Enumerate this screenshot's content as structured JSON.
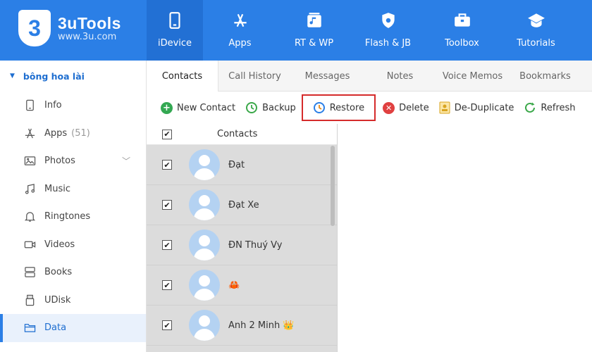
{
  "app": {
    "name": "3uTools",
    "url": "www.3u.com"
  },
  "nav": [
    {
      "label": "iDevice",
      "icon": "phone-icon"
    },
    {
      "label": "Apps",
      "icon": "app-store-icon"
    },
    {
      "label": "RT & WP",
      "icon": "music-note-icon"
    },
    {
      "label": "Flash & JB",
      "icon": "shield-icon"
    },
    {
      "label": "Toolbox",
      "icon": "toolbox-icon"
    },
    {
      "label": "Tutorials",
      "icon": "graduation-cap-icon"
    }
  ],
  "sidebar": {
    "device": "bông hoa lài",
    "items": [
      {
        "label": "Info",
        "icon": "info-icon"
      },
      {
        "label": "Apps",
        "count": "(51)",
        "icon": "apps-icon"
      },
      {
        "label": "Photos",
        "icon": "photo-icon"
      },
      {
        "label": "Music",
        "icon": "music-icon"
      },
      {
        "label": "Ringtones",
        "icon": "bell-icon"
      },
      {
        "label": "Videos",
        "icon": "video-icon"
      },
      {
        "label": "Books",
        "icon": "book-icon"
      },
      {
        "label": "UDisk",
        "icon": "usb-icon"
      },
      {
        "label": "Data",
        "icon": "folder-icon"
      }
    ]
  },
  "tabs": [
    "Contacts",
    "Call History",
    "Messages",
    "Notes",
    "Voice Memos",
    "Bookmarks"
  ],
  "toolbar": {
    "new_contact": "New Contact",
    "backup": "Backup",
    "restore": "Restore",
    "delete": "Delete",
    "dedupe": "De-Duplicate",
    "refresh": "Refresh"
  },
  "contacts": {
    "header": "Contacts",
    "rows": [
      "Đạt",
      "Đạt Xe",
      "ĐN Thuý Vy",
      "🦀",
      "Anh 2 Minh 👑"
    ]
  },
  "colors": {
    "brand": "#2b7fe6",
    "highlight_box": "#d52b2b"
  }
}
